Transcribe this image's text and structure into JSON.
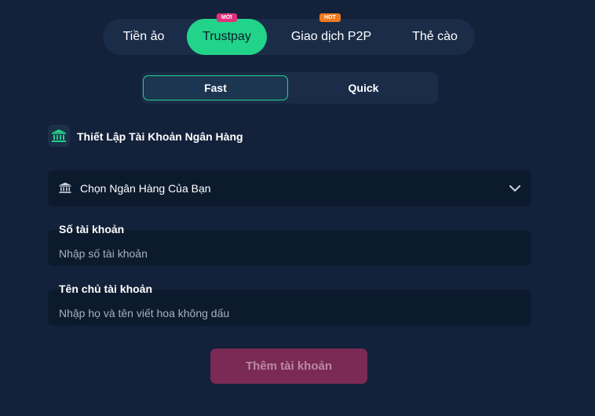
{
  "colors": {
    "background": "#13213a",
    "accent": "#22d38a",
    "badge_new": "#e0307a",
    "badge_hot": "#f07a1e",
    "submit_disabled": "#7a2a55"
  },
  "method_tabs": [
    {
      "label": "Tiền ảo",
      "active": false
    },
    {
      "label": "Trustpay",
      "active": true,
      "badge": "MỚI"
    },
    {
      "label": "Giao dịch P2P",
      "active": false,
      "badge": "HOT"
    },
    {
      "label": "Thẻ cào",
      "active": false
    }
  ],
  "mode_tabs": [
    {
      "label": "Fast",
      "active": true
    },
    {
      "label": "Quick",
      "active": false
    }
  ],
  "section": {
    "icon": "bank-icon",
    "title": "Thiết Lập Tài Khoản Ngân Hàng"
  },
  "bank_select": {
    "icon": "bank-icon",
    "placeholder": "Chọn Ngân Hàng Của Bạn"
  },
  "fields": {
    "account_number": {
      "label": "Số tài khoản",
      "placeholder": "Nhập số tài khoản",
      "value": ""
    },
    "account_holder": {
      "label": "Tên chủ tài khoản",
      "placeholder": "Nhập họ và tên viết hoa không dấu",
      "value": ""
    }
  },
  "submit": {
    "label": "Thêm tài khoản",
    "enabled": false
  }
}
